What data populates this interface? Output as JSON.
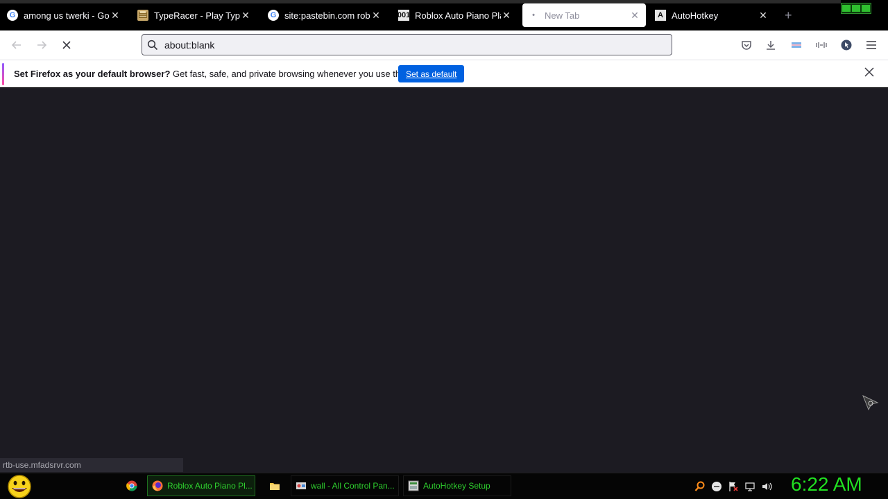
{
  "tabs": [
    {
      "title": "among us twerki - Googl",
      "favicon": "google-icon",
      "active": false
    },
    {
      "title": "TypeRacer - Play Typing",
      "favicon": "typeracer-icon",
      "active": false
    },
    {
      "title": "site:pastebin.com roblox",
      "favicon": "google-icon",
      "active": false
    },
    {
      "title": "Roblox Auto Piano Playe",
      "favicon": "roblox-piano-icon",
      "active": false
    },
    {
      "title": "New Tab",
      "favicon": "loading-dot-icon",
      "active": true
    },
    {
      "title": "AutoHotkey",
      "favicon": "autohotkey-icon",
      "active": false
    }
  ],
  "favicon_letters": {
    "google": "G",
    "roblox": "001"
  },
  "ahk_letter": "A",
  "newtab_symbol": "+",
  "close_symbol": "✕",
  "urlbar": {
    "value": "about:blank"
  },
  "notification": {
    "bold_text": "Set Firefox as your default browser?",
    "text": " Get fast, safe, and private browsing whenever you use the web.",
    "button_label": "Set as default"
  },
  "status_link": "rtb-use.mfadsrvr.com",
  "taskbar": {
    "items": [
      {
        "label": "Roblox Auto Piano Pl...",
        "icon": "firefox-icon"
      },
      {
        "label": "wall - All Control Pan...",
        "icon": "control-panel-icon"
      },
      {
        "label": "AutoHotkey Setup",
        "icon": "autohotkey-setup-icon"
      }
    ],
    "clock": "6:22 AM"
  },
  "colors": {
    "accent_blue": "#0061e0",
    "taskbar_green": "#2ecf2e",
    "clock_green": "#21e021",
    "content_bg": "#1c1b22"
  }
}
